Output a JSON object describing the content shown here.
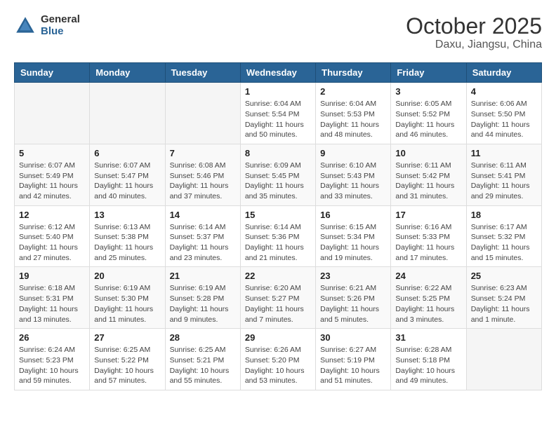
{
  "header": {
    "logo_general": "General",
    "logo_blue": "Blue",
    "title": "October 2025",
    "subtitle": "Daxu, Jiangsu, China"
  },
  "weekdays": [
    "Sunday",
    "Monday",
    "Tuesday",
    "Wednesday",
    "Thursday",
    "Friday",
    "Saturday"
  ],
  "weeks": [
    [
      {
        "day": "",
        "info": ""
      },
      {
        "day": "",
        "info": ""
      },
      {
        "day": "",
        "info": ""
      },
      {
        "day": "1",
        "info": "Sunrise: 6:04 AM\nSunset: 5:54 PM\nDaylight: 11 hours and 50 minutes."
      },
      {
        "day": "2",
        "info": "Sunrise: 6:04 AM\nSunset: 5:53 PM\nDaylight: 11 hours and 48 minutes."
      },
      {
        "day": "3",
        "info": "Sunrise: 6:05 AM\nSunset: 5:52 PM\nDaylight: 11 hours and 46 minutes."
      },
      {
        "day": "4",
        "info": "Sunrise: 6:06 AM\nSunset: 5:50 PM\nDaylight: 11 hours and 44 minutes."
      }
    ],
    [
      {
        "day": "5",
        "info": "Sunrise: 6:07 AM\nSunset: 5:49 PM\nDaylight: 11 hours and 42 minutes."
      },
      {
        "day": "6",
        "info": "Sunrise: 6:07 AM\nSunset: 5:47 PM\nDaylight: 11 hours and 40 minutes."
      },
      {
        "day": "7",
        "info": "Sunrise: 6:08 AM\nSunset: 5:46 PM\nDaylight: 11 hours and 37 minutes."
      },
      {
        "day": "8",
        "info": "Sunrise: 6:09 AM\nSunset: 5:45 PM\nDaylight: 11 hours and 35 minutes."
      },
      {
        "day": "9",
        "info": "Sunrise: 6:10 AM\nSunset: 5:43 PM\nDaylight: 11 hours and 33 minutes."
      },
      {
        "day": "10",
        "info": "Sunrise: 6:11 AM\nSunset: 5:42 PM\nDaylight: 11 hours and 31 minutes."
      },
      {
        "day": "11",
        "info": "Sunrise: 6:11 AM\nSunset: 5:41 PM\nDaylight: 11 hours and 29 minutes."
      }
    ],
    [
      {
        "day": "12",
        "info": "Sunrise: 6:12 AM\nSunset: 5:40 PM\nDaylight: 11 hours and 27 minutes."
      },
      {
        "day": "13",
        "info": "Sunrise: 6:13 AM\nSunset: 5:38 PM\nDaylight: 11 hours and 25 minutes."
      },
      {
        "day": "14",
        "info": "Sunrise: 6:14 AM\nSunset: 5:37 PM\nDaylight: 11 hours and 23 minutes."
      },
      {
        "day": "15",
        "info": "Sunrise: 6:14 AM\nSunset: 5:36 PM\nDaylight: 11 hours and 21 minutes."
      },
      {
        "day": "16",
        "info": "Sunrise: 6:15 AM\nSunset: 5:34 PM\nDaylight: 11 hours and 19 minutes."
      },
      {
        "day": "17",
        "info": "Sunrise: 6:16 AM\nSunset: 5:33 PM\nDaylight: 11 hours and 17 minutes."
      },
      {
        "day": "18",
        "info": "Sunrise: 6:17 AM\nSunset: 5:32 PM\nDaylight: 11 hours and 15 minutes."
      }
    ],
    [
      {
        "day": "19",
        "info": "Sunrise: 6:18 AM\nSunset: 5:31 PM\nDaylight: 11 hours and 13 minutes."
      },
      {
        "day": "20",
        "info": "Sunrise: 6:19 AM\nSunset: 5:30 PM\nDaylight: 11 hours and 11 minutes."
      },
      {
        "day": "21",
        "info": "Sunrise: 6:19 AM\nSunset: 5:28 PM\nDaylight: 11 hours and 9 minutes."
      },
      {
        "day": "22",
        "info": "Sunrise: 6:20 AM\nSunset: 5:27 PM\nDaylight: 11 hours and 7 minutes."
      },
      {
        "day": "23",
        "info": "Sunrise: 6:21 AM\nSunset: 5:26 PM\nDaylight: 11 hours and 5 minutes."
      },
      {
        "day": "24",
        "info": "Sunrise: 6:22 AM\nSunset: 5:25 PM\nDaylight: 11 hours and 3 minutes."
      },
      {
        "day": "25",
        "info": "Sunrise: 6:23 AM\nSunset: 5:24 PM\nDaylight: 11 hours and 1 minute."
      }
    ],
    [
      {
        "day": "26",
        "info": "Sunrise: 6:24 AM\nSunset: 5:23 PM\nDaylight: 10 hours and 59 minutes."
      },
      {
        "day": "27",
        "info": "Sunrise: 6:25 AM\nSunset: 5:22 PM\nDaylight: 10 hours and 57 minutes."
      },
      {
        "day": "28",
        "info": "Sunrise: 6:25 AM\nSunset: 5:21 PM\nDaylight: 10 hours and 55 minutes."
      },
      {
        "day": "29",
        "info": "Sunrise: 6:26 AM\nSunset: 5:20 PM\nDaylight: 10 hours and 53 minutes."
      },
      {
        "day": "30",
        "info": "Sunrise: 6:27 AM\nSunset: 5:19 PM\nDaylight: 10 hours and 51 minutes."
      },
      {
        "day": "31",
        "info": "Sunrise: 6:28 AM\nSunset: 5:18 PM\nDaylight: 10 hours and 49 minutes."
      },
      {
        "day": "",
        "info": ""
      }
    ]
  ]
}
